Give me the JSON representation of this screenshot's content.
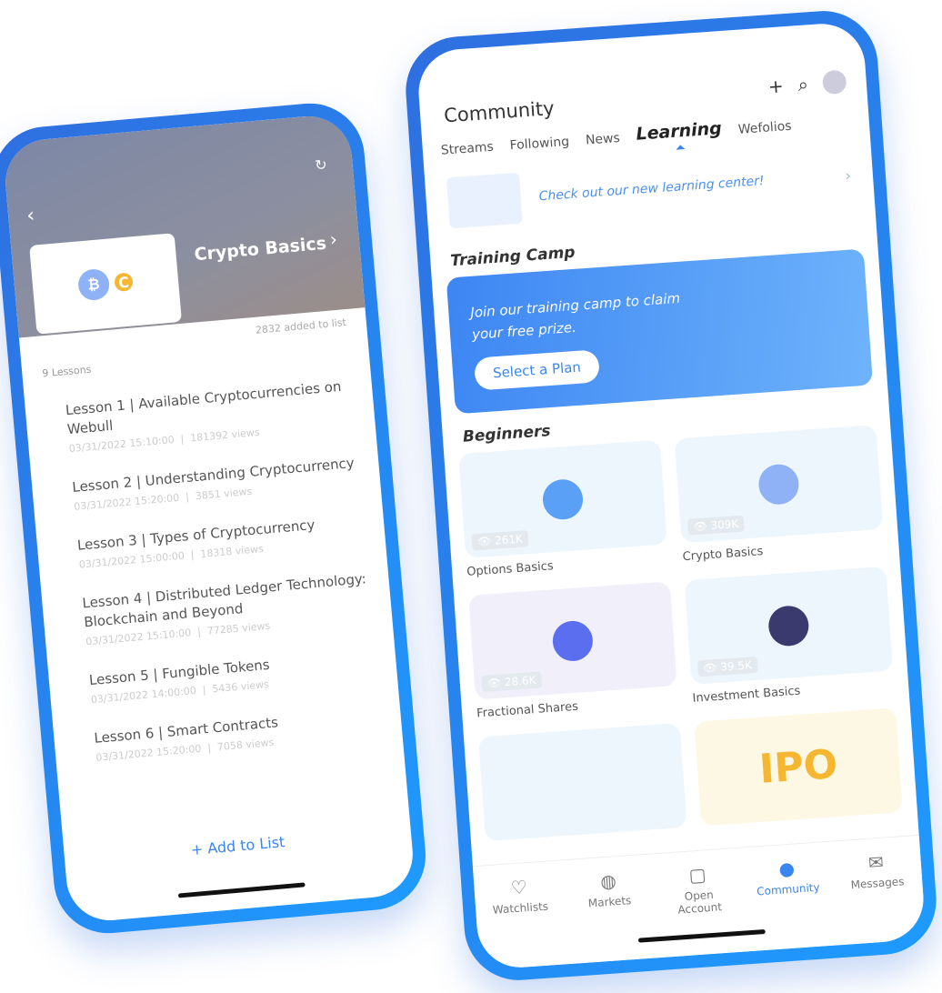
{
  "left_phone": {
    "course_title": "Crypto Basics",
    "added": "2832 added to list",
    "lessons_count": "9 Lessons",
    "lessons": [
      {
        "title": "Lesson 1 | Available Cryptocurrencies on Webull",
        "date": "03/31/2022 15:10:00",
        "views": "181392 views"
      },
      {
        "title": "Lesson 2 | Understanding Cryptocurrency",
        "date": "03/31/2022 15:20:00",
        "views": "3851 views"
      },
      {
        "title": "Lesson 3 | Types of Cryptocurrency",
        "date": "03/31/2022 15:00:00",
        "views": "18318 views"
      },
      {
        "title": "Lesson 4 | Distributed Ledger Technology: Blockchain and Beyond",
        "date": "03/31/2022 15:10:00",
        "views": "77285 views"
      },
      {
        "title": "Lesson 5 | Fungible Tokens",
        "date": "03/31/2022 14:00:00",
        "views": "5436 views"
      },
      {
        "title": "Lesson 6 | Smart Contracts",
        "date": "03/31/2022 15:20:00",
        "views": "7058 views"
      }
    ],
    "add_to_list": "+ Add to List"
  },
  "right_phone": {
    "title": "Community",
    "tabs": [
      "Streams",
      "Following",
      "News",
      "Learning",
      "Wefolios"
    ],
    "active_tab": "Learning",
    "banner": "Check out our new learning center!",
    "training_title": "Training Camp",
    "training_text": "Join our training camp to claim your free prize.",
    "plan_button": "Select a Plan",
    "beginners_title": "Beginners",
    "courses": [
      {
        "label": "Options Basics",
        "views": "261K"
      },
      {
        "label": "Crypto Basics",
        "views": "309K"
      },
      {
        "label": "Fractional Shares",
        "views": "28.6K"
      },
      {
        "label": "Investment Basics",
        "views": "39.5K"
      }
    ],
    "ipo_label": "IPO",
    "nav": [
      "Watchlists",
      "Markets",
      "Open Account",
      "Community",
      "Messages"
    ],
    "accent": "#3a86f0"
  }
}
